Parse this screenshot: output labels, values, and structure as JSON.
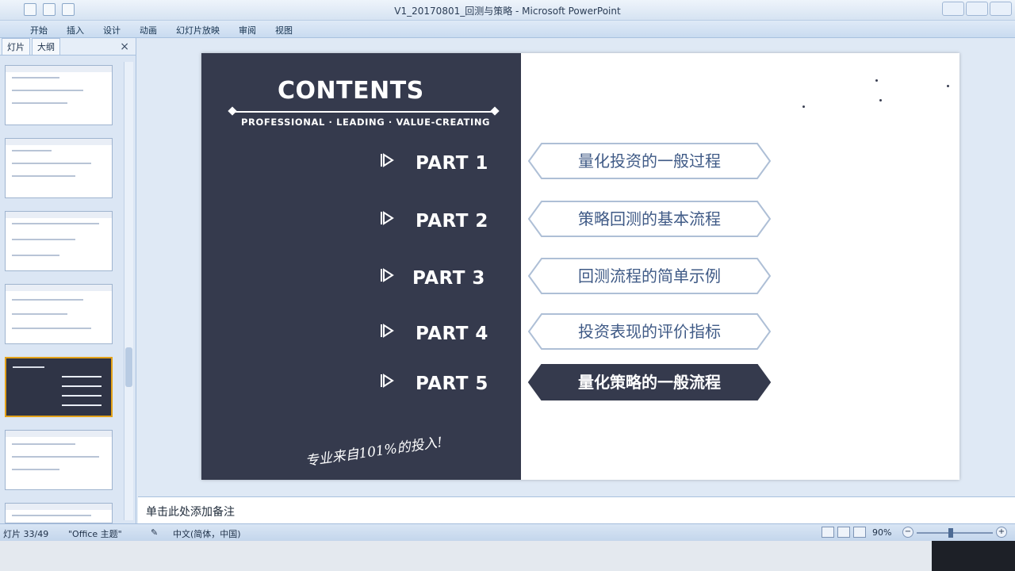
{
  "window": {
    "title": "V1_20170801_回测与策略 - Microsoft PowerPoint"
  },
  "ribbon": {
    "tabs": [
      "开始",
      "插入",
      "设计",
      "动画",
      "幻灯片放映",
      "审阅",
      "视图"
    ]
  },
  "leftpane": {
    "tabs": [
      "灯片",
      "大纲"
    ],
    "close": "×"
  },
  "slide": {
    "heading": "CONTENTS",
    "subtitle": "PROFESSIONAL · LEADING · VALUE-CREATING",
    "parts": [
      {
        "label": "PART 1",
        "topic": "量化投资的一般过程",
        "active": false
      },
      {
        "label": "PART 2",
        "topic": "策略回测的基本流程",
        "active": false
      },
      {
        "label": "PART 3",
        "topic": "回测流程的简单示例",
        "active": false
      },
      {
        "label": "PART 4",
        "topic": "投资表现的评价指标",
        "active": false
      },
      {
        "label": "PART 5",
        "topic": "量化策略的一般流程",
        "active": true
      }
    ],
    "handwriting": "专业来自101%的投入!",
    "colors": {
      "dark": "#353a4d",
      "pill_border": "#aebfd6",
      "pill_active": "#353a4d",
      "pill_text": "#3f5a86"
    }
  },
  "notes": {
    "placeholder": "单击此处添加备注"
  },
  "status": {
    "slide_counter": "灯片 33/49",
    "theme": "\"Office 主题\"",
    "language": "中文(简体，中国)",
    "zoom": "90%"
  }
}
